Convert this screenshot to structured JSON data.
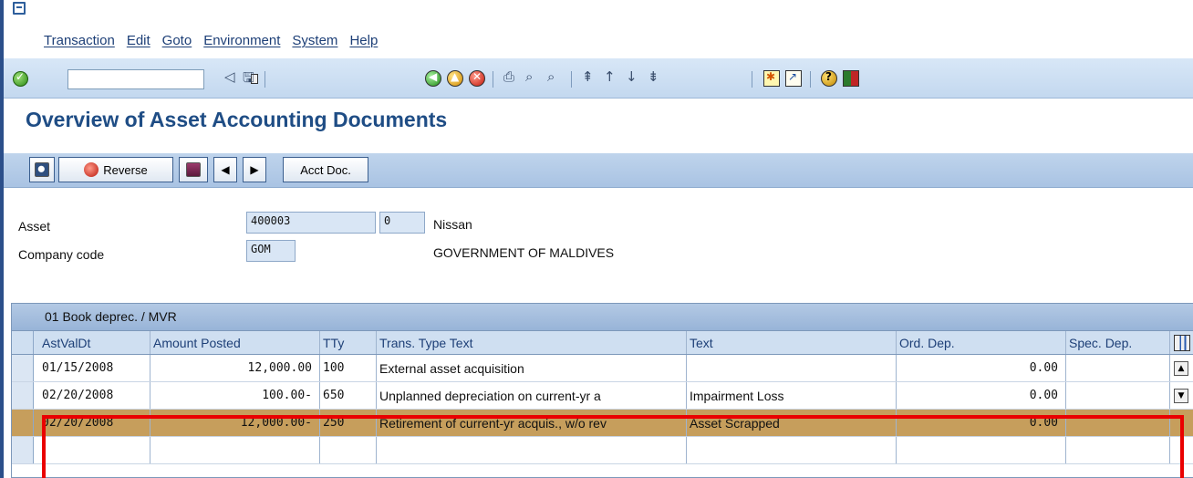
{
  "menu": [
    "Transaction",
    "Edit",
    "Goto",
    "Environment",
    "System",
    "Help"
  ],
  "page_title": "Overview of Asset Accounting Documents",
  "app_toolbar": {
    "reverse_label": "Reverse",
    "acct_doc_label": "Acct Doc.",
    "prev_glyph": "◀",
    "next_glyph": "▶"
  },
  "header": {
    "asset_label": "Asset",
    "asset_number": "400003",
    "asset_sub": "0",
    "asset_description": "Nissan",
    "company_code_label": "Company code",
    "company_code": "GOM",
    "company_name": "GOVERNMENT OF MALDIVES"
  },
  "table": {
    "caption": "01 Book deprec. / MVR",
    "columns": [
      "AstValDt",
      "Amount Posted",
      "TTy",
      "Trans. Type Text",
      "Text",
      "Ord. Dep.",
      "Spec. Dep."
    ],
    "rows": [
      {
        "date": "01/15/2008",
        "amount": "12,000.00",
        "tty": "100",
        "ttext": "External asset acquisition",
        "text": "",
        "ord": "0.00",
        "spec": ""
      },
      {
        "date": "02/20/2008",
        "amount": "100.00-",
        "tty": "650",
        "ttext": "Unplanned depreciation on current-yr a",
        "text": "Impairment Loss",
        "ord": "0.00",
        "spec": ""
      },
      {
        "date": "02/20/2008",
        "amount": "12,000.00-",
        "tty": "250",
        "ttext": "Retirement of current-yr acquis., w/o rev",
        "text": "Asset Scrapped",
        "ord": "0.00",
        "spec": ""
      }
    ]
  }
}
